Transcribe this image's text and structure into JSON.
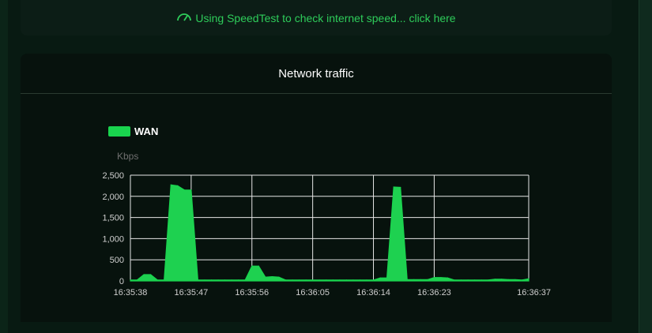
{
  "speedtest": {
    "icon": "speedometer-icon",
    "link_text": "Using SpeedTest to check internet speed... click here"
  },
  "panel": {
    "title": "Network traffic"
  },
  "colors": {
    "accent": "#19d44e",
    "fill": "#1ed150",
    "grid": "#e6e6e6",
    "link": "#2ecc5a"
  },
  "chart_data": {
    "type": "area",
    "title": "",
    "ylabel": "Kbps",
    "xlabel": "",
    "legend": {
      "entries": [
        "WAN"
      ],
      "placement": "top-left"
    },
    "ylim": [
      0,
      2500
    ],
    "y_ticks": [
      "2,500",
      "2,000",
      "1,500",
      "1,000",
      "500",
      "0"
    ],
    "x_ticks": [
      "16:35:38",
      "16:35:47",
      "16:35:56",
      "16:36:05",
      "16:36:14",
      "16:36:23",
      "16:36:37"
    ],
    "grid": true,
    "series": [
      {
        "name": "WAN",
        "x": [
          "16:35:38",
          "16:35:39",
          "16:35:40",
          "16:35:41",
          "16:35:42",
          "16:35:43",
          "16:35:44",
          "16:35:45",
          "16:35:46",
          "16:35:47",
          "16:35:48",
          "16:35:49",
          "16:35:50",
          "16:35:51",
          "16:35:52",
          "16:35:53",
          "16:35:54",
          "16:35:55",
          "16:35:56",
          "16:35:57",
          "16:35:58",
          "16:35:59",
          "16:36:00",
          "16:36:01",
          "16:36:02",
          "16:36:03",
          "16:36:04",
          "16:36:05",
          "16:36:06",
          "16:36:07",
          "16:36:08",
          "16:36:09",
          "16:36:10",
          "16:36:11",
          "16:36:12",
          "16:36:13",
          "16:36:14",
          "16:36:15",
          "16:36:16",
          "16:36:17",
          "16:36:18",
          "16:36:19",
          "16:36:20",
          "16:36:21",
          "16:36:22",
          "16:36:23",
          "16:36:24",
          "16:36:25",
          "16:36:26",
          "16:36:27",
          "16:36:28",
          "16:36:29",
          "16:36:30",
          "16:36:31",
          "16:36:32",
          "16:36:33",
          "16:36:34",
          "16:36:35",
          "16:36:36",
          "16:36:37"
        ],
        "values": [
          20,
          20,
          150,
          150,
          20,
          20,
          2270,
          2250,
          2150,
          2150,
          20,
          20,
          20,
          20,
          20,
          20,
          20,
          20,
          350,
          350,
          90,
          100,
          90,
          20,
          20,
          20,
          20,
          20,
          20,
          20,
          20,
          20,
          20,
          20,
          20,
          20,
          20,
          70,
          70,
          2220,
          2210,
          30,
          30,
          30,
          30,
          80,
          80,
          70,
          20,
          20,
          20,
          20,
          20,
          20,
          40,
          40,
          30,
          30,
          20,
          50
        ]
      }
    ]
  }
}
